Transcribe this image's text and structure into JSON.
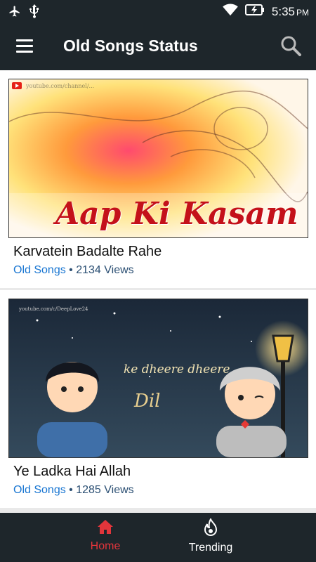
{
  "status_bar": {
    "time": "5:35",
    "ampm": "PM"
  },
  "app_bar": {
    "title": "Old Songs Status"
  },
  "videos": [
    {
      "title": "Karvatein Badalte Rahe",
      "category": "Old Songs",
      "separator": " • ",
      "views": "2134 Views",
      "overlay_text": "Aap Ki Kasam",
      "watermark": "youtube.com/channel/..."
    },
    {
      "title": "Ye Ladka Hai Allah",
      "category": "Old Songs",
      "separator": " • ",
      "views": "1285 Views",
      "overlay_line1": "ke dheere dheere",
      "overlay_line2": "Dil",
      "watermark": "youtube.com/c/DeepLove24"
    }
  ],
  "bottom_nav": {
    "items": [
      {
        "label": "Home",
        "active": true
      },
      {
        "label": "Trending",
        "active": false
      }
    ]
  },
  "colors": {
    "bar": "#1e262b",
    "accent": "#e2353b",
    "meta": "#1976d2"
  }
}
